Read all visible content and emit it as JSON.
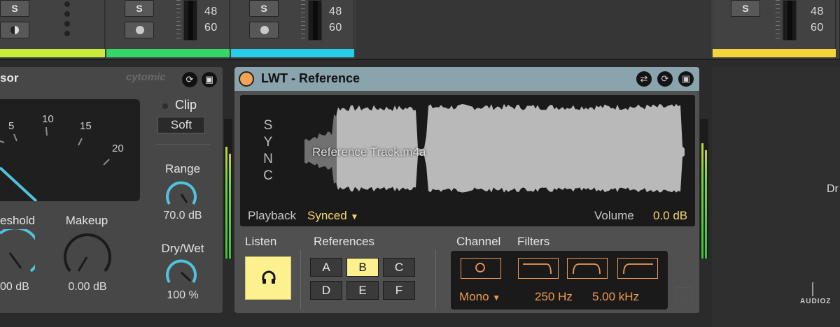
{
  "mixer": {
    "solo_label": "S",
    "meter_marks": [
      "48",
      "60"
    ],
    "track_colors": [
      "#c8ec3b",
      "#34d669",
      "#27cde8",
      "#f2d53a"
    ]
  },
  "compressor": {
    "title_fragment": "sor",
    "brand": "cytomic",
    "icons": [
      "refresh-icon",
      "save-icon"
    ],
    "meter_scale": [
      "5",
      "10",
      "15",
      "20"
    ],
    "clip_label": "Clip",
    "mode_button": "Soft",
    "range_label": "Range",
    "range_value": "70.0 dB",
    "range_level": 0.7,
    "threshold_label": "eshold",
    "threshold_value": "00 dB",
    "makeup_label": "Makeup",
    "makeup_value": "0.00 dB",
    "drywet_label": "Dry/Wet",
    "drywet_value": "100 %",
    "drywet_level": 1.0
  },
  "lwt": {
    "title": "LWT - Reference",
    "header_icons": [
      "swap-icon",
      "refresh-icon",
      "save-icon"
    ],
    "sync_letters": [
      "S",
      "Y",
      "N",
      "C"
    ],
    "track_name": "Reference Track.m4a",
    "playback_label": "Playback",
    "playback_value": "Synced",
    "dropdown_glyph": "▼",
    "volume_label": "Volume",
    "volume_value": "0.0 dB",
    "listen_label": "Listen",
    "references_label": "References",
    "references": [
      "A",
      "B",
      "C",
      "D",
      "E",
      "F"
    ],
    "active_reference": "B",
    "channel_label": "Channel",
    "channel_value": "Mono",
    "filters_label": "Filters",
    "hpf_value": "250 Hz",
    "lpf_value": "5.00 kHz",
    "accent_color": "#f09a4f",
    "highlight_color": "#fdf08e"
  },
  "right_panel": {
    "text_fragment": "Dr"
  },
  "watermark": "AUDIOZ"
}
